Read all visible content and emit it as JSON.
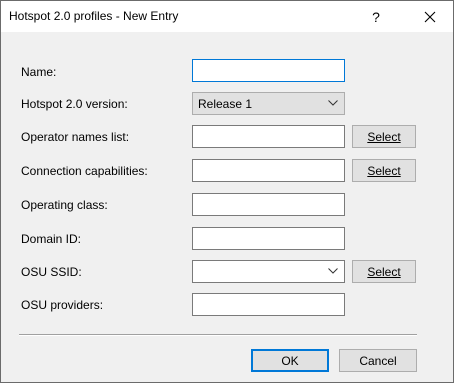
{
  "window": {
    "title": "Hotspot 2.0 profiles - New Entry",
    "help_glyph": "?",
    "close_glyph": "✕"
  },
  "form": {
    "name": {
      "label": "Name:",
      "value": ""
    },
    "version": {
      "label": "Hotspot 2.0 version:",
      "value": "Release 1"
    },
    "operator_names": {
      "label": "Operator names list:",
      "value": "",
      "button": "Select"
    },
    "connection_capabilities": {
      "label": "Connection capabilities:",
      "value": "",
      "button": "Select"
    },
    "operating_class": {
      "label": "Operating class:",
      "value": ""
    },
    "domain_id": {
      "label": "Domain ID:",
      "value": ""
    },
    "osu_ssid": {
      "label": "OSU SSID:",
      "value": "",
      "button": "Select"
    },
    "osu_providers": {
      "label": "OSU providers:",
      "value": ""
    }
  },
  "footer": {
    "ok_label": "OK",
    "cancel_label": "Cancel"
  },
  "icons": {
    "chevron": "chevron-down-icon"
  }
}
